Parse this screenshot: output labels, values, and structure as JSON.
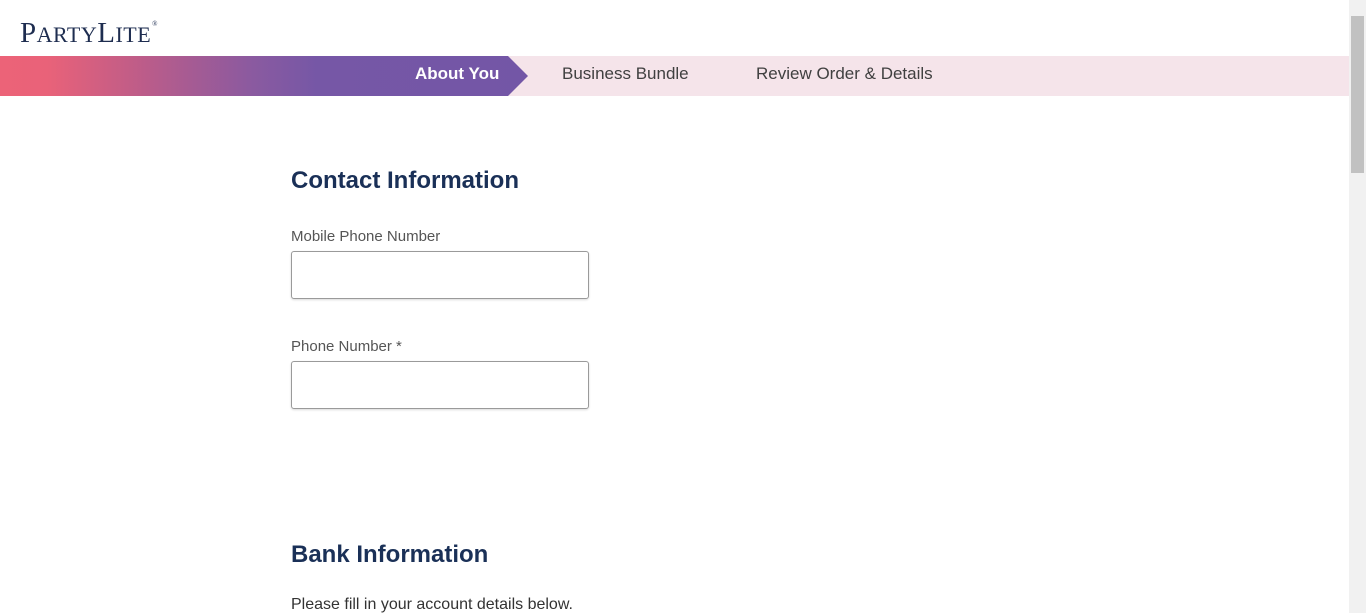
{
  "header": {
    "logo_big_p": "P",
    "logo_rest_party": "ARTY",
    "logo_big_l": "L",
    "logo_rest_lite": "ITE",
    "logo_mark": "®"
  },
  "stepper": {
    "steps": [
      {
        "label": "About You",
        "active": true
      },
      {
        "label": "Business Bundle",
        "active": false
      },
      {
        "label": "Review Order & Details",
        "active": false
      }
    ]
  },
  "contact": {
    "title": "Contact Information",
    "mobile_label": "Mobile Phone Number",
    "mobile_value": "",
    "phone_label": "Phone Number *",
    "phone_value": ""
  },
  "bank": {
    "title": "Bank Information",
    "instructions": "Please fill in your account details below."
  },
  "colors": {
    "brand_navy": "#1e2d50",
    "heading": "#1a3057",
    "step_active_purple": "#7356a6",
    "step_gradient_pink": "#ec6378",
    "stepper_bg": "#f5e4ea"
  }
}
